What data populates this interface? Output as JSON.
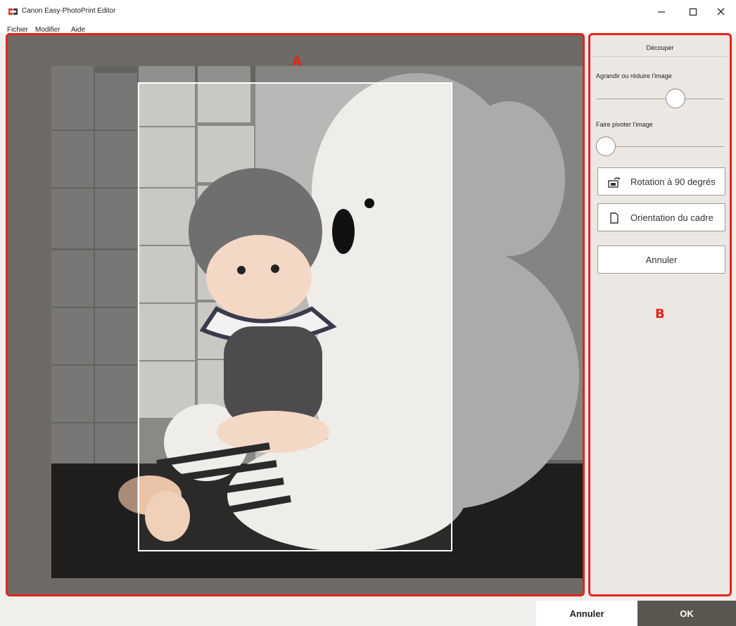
{
  "window": {
    "title": "Canon Easy-PhotoPrint Editor",
    "controls": {
      "minimize": "minimize-icon",
      "maximize": "maximize-icon",
      "close": "close-icon"
    }
  },
  "menu": [
    "Fichier",
    "Modifier",
    "Aide"
  ],
  "preview": {
    "area_label": "A",
    "image": "photo: baby in knit hat with white teddy bear"
  },
  "panel": {
    "area_label": "B",
    "title": "Découper",
    "zoom": {
      "label": "Agrandir ou réduire l'image",
      "value_fraction": 0.62
    },
    "rotate": {
      "label": "Faire pivoter l'image",
      "value_fraction": 0.0
    },
    "rotate90_label": "Rotation à 90 degrés",
    "orientation_label": "Orientation du cadre",
    "undo_label": "Annuler"
  },
  "footer": {
    "cancel_label": "Annuler",
    "ok_label": "OK"
  },
  "colors": {
    "highlight": "#e8221a",
    "ok_button": "#5b5550",
    "panel_bg": "#ebe8e3"
  }
}
